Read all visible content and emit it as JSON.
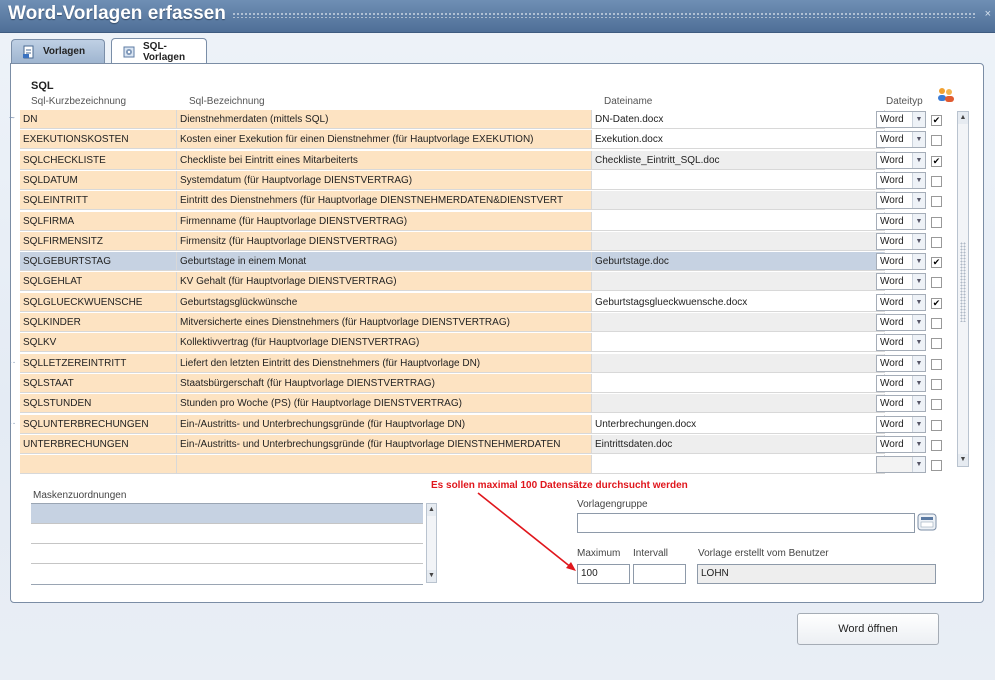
{
  "window": {
    "title": "Word-Vorlagen erfassen",
    "close_glyph": "×"
  },
  "tabs": [
    {
      "label": "Vorlagen",
      "icon": "document-icon",
      "active": false
    },
    {
      "label": "SQL-Vorlagen",
      "icon": "database-gear-icon",
      "active": true
    }
  ],
  "sql": {
    "section_title": "SQL",
    "columns": {
      "short": "Sql-Kurzbezeichnung",
      "desc": "Sql-Bezeichnung",
      "file": "Dateiname",
      "type": "Dateityp"
    },
    "rows": [
      {
        "marker": "~",
        "short": "DN",
        "desc": "Dienstnehmerdaten (mittels SQL)",
        "file": "DN-Daten.docx",
        "type": "Word",
        "checked": true,
        "file_grey": false,
        "selected": false
      },
      {
        "marker": "",
        "short": "EXEKUTIONSKOSTEN",
        "desc": "Kosten einer Exekution für einen Dienstnehmer (für Hauptvorlage EXEKUTION)",
        "file": "Exekution.docx",
        "type": "Word",
        "checked": false,
        "file_grey": false,
        "selected": false
      },
      {
        "marker": "",
        "short": "SQLCHECKLISTE",
        "desc": "Checkliste bei Eintritt eines Mitarbeiterts",
        "file": "Checkliste_Eintritt_SQL.doc",
        "type": "Word",
        "checked": true,
        "file_grey": true,
        "selected": false
      },
      {
        "marker": "",
        "short": "SQLDATUM",
        "desc": "Systemdatum (für Hauptvorlage DIENSTVERTRAG)",
        "file": "",
        "type": "Word",
        "checked": false,
        "file_grey": false,
        "selected": false
      },
      {
        "marker": "",
        "short": "SQLEINTRITT",
        "desc": "Eintritt des Dienstnehmers (für Hauptvorlage DIENSTNEHMERDATEN&DIENSTVERT",
        "file": "",
        "type": "Word",
        "checked": false,
        "file_grey": true,
        "selected": false
      },
      {
        "marker": "",
        "short": "SQLFIRMA",
        "desc": "Firmenname (für Hauptvorlage DIENSTVERTRAG)",
        "file": "",
        "type": "Word",
        "checked": false,
        "file_grey": false,
        "selected": false
      },
      {
        "marker": "",
        "short": "SQLFIRMENSITZ",
        "desc": "Firmensitz (für Hauptvorlage DIENSTVERTRAG)",
        "file": "",
        "type": "Word",
        "checked": false,
        "file_grey": true,
        "selected": false
      },
      {
        "marker": "",
        "short": "SQLGEBURTSTAG",
        "desc": "Geburtstage in einem Monat",
        "file": "Geburtstage.doc",
        "type": "Word",
        "checked": true,
        "file_grey": false,
        "selected": true
      },
      {
        "marker": "",
        "short": "SQLGEHLAT",
        "desc": "KV Gehalt (für Hauptvorlage DIENSTVERTRAG)",
        "file": "",
        "type": "Word",
        "checked": false,
        "file_grey": true,
        "selected": false
      },
      {
        "marker": "",
        "short": "SQLGLUECKWUENSCHE",
        "desc": "Geburtstagsglückwünsche",
        "file": "Geburtstagsglueckwuensche.docx",
        "type": "Word",
        "checked": true,
        "file_grey": false,
        "selected": false
      },
      {
        "marker": "",
        "short": "SQLKINDER",
        "desc": "Mitversicherte eines Dienstnehmers (für Hauptvorlage DIENSTVERTRAG)",
        "file": "",
        "type": "Word",
        "checked": false,
        "file_grey": true,
        "selected": false
      },
      {
        "marker": "",
        "short": "SQLKV",
        "desc": "Kollektivvertrag (für Hauptvorlage DIENSTVERTRAG)",
        "file": "",
        "type": "Word",
        "checked": false,
        "file_grey": false,
        "selected": false
      },
      {
        "marker": "··",
        "short": "SQLLETZEREINTRITT",
        "desc": "Liefert den letzten Eintritt des Dienstnehmers (für Hauptvorlage DN)",
        "file": "",
        "type": "Word",
        "checked": false,
        "file_grey": true,
        "selected": false
      },
      {
        "marker": "",
        "short": "SQLSTAAT",
        "desc": "Staatsbürgerschaft (für Hauptvorlage DIENSTVERTRAG)",
        "file": "",
        "type": "Word",
        "checked": false,
        "file_grey": false,
        "selected": false
      },
      {
        "marker": "",
        "short": "SQLSTUNDEN",
        "desc": "Stunden pro Woche (PS) (für Hauptvorlage DIENSTVERTRAG)",
        "file": "",
        "type": "Word",
        "checked": false,
        "file_grey": true,
        "selected": false
      },
      {
        "marker": "··",
        "short": "SQLUNTERBRECHUNGEN",
        "desc": "Ein-/Austritts- und Unterbrechungsgründe (für Hauptvorlage DN)",
        "file": "Unterbrechungen.docx",
        "type": "Word",
        "checked": false,
        "file_grey": false,
        "selected": false
      },
      {
        "marker": "",
        "short": "UNTERBRECHUNGEN",
        "desc": "Ein-/Austritts- und Unterbrechungsgründe (für Hauptvorlage DIENSTNEHMERDATEN",
        "file": "Eintrittsdaten.doc",
        "type": "Word",
        "checked": false,
        "file_grey": true,
        "selected": false
      },
      {
        "marker": "",
        "short": "",
        "desc": "",
        "file": "",
        "type": "",
        "checked": false,
        "file_grey": false,
        "selected": false
      }
    ]
  },
  "annotation": {
    "text": "Es sollen maximal 100 Datensätze durchsucht werden",
    "color": "#e0161c"
  },
  "masks": {
    "label": "Maskenzuordnungen"
  },
  "form": {
    "group_label": "Vorlagengruppe",
    "group_value": "",
    "max_label": "Maximum",
    "max_value": "100",
    "interval_label": "Intervall",
    "interval_value": "",
    "user_label": "Vorlage erstellt vom Benutzer",
    "user_value": "LOHN"
  },
  "actions": {
    "open_word": "Word öffnen"
  }
}
